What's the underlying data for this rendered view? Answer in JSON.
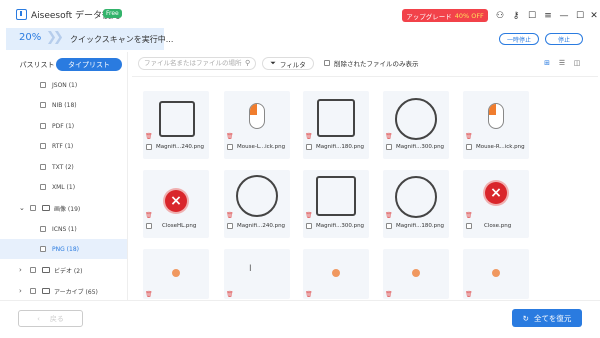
{
  "app": {
    "title": "Aiseesoft データ復元",
    "badge": "Free",
    "promo_label": "アップグレード",
    "promo_discount": "40% OFF",
    "icons": [
      "cart-icon",
      "key-icon",
      "chat-icon",
      "menu-icon",
      "minimize-icon",
      "maximize-icon",
      "close-icon"
    ]
  },
  "scan": {
    "percent": "20%",
    "progress": 0.2,
    "status": "クイックスキャンを実行中...",
    "pause_label": "一時停止",
    "stop_label": "停止"
  },
  "tabs": {
    "path_list": "パスリスト",
    "type_list": "タイプリスト"
  },
  "tree": [
    {
      "label": "JSON (1)",
      "level": 1
    },
    {
      "label": "NIB (18)",
      "level": 1
    },
    {
      "label": "PDF (1)",
      "level": 1
    },
    {
      "label": "RTF (1)",
      "level": 1
    },
    {
      "label": "TXT (2)",
      "level": 1
    },
    {
      "label": "XML (1)",
      "level": 1
    },
    {
      "label": "画像 (19)",
      "level": 0,
      "expanded": true
    },
    {
      "label": "ICNS (1)",
      "level": 1
    },
    {
      "label": "PNG (18)",
      "level": 1,
      "selected": true
    },
    {
      "label": "ビデオ (2)",
      "level": 0,
      "expanded": false
    },
    {
      "label": "アーカイブ (65)",
      "level": 0,
      "expanded": false
    }
  ],
  "toolbar": {
    "search_placeholder": "ファイル名またはファイルの場所",
    "filter_label": "フィルタ",
    "deleted_only_label": "削除されたファイルのみ表示"
  },
  "files": [
    {
      "name": "Magnifi...240.png",
      "kind": "square"
    },
    {
      "name": "Mouse-L...ick.png",
      "kind": "mouse-left"
    },
    {
      "name": "Magnifi...180.png",
      "kind": "square"
    },
    {
      "name": "Magnifi...300.png",
      "kind": "circle"
    },
    {
      "name": "Mouse-R...ick.png",
      "kind": "mouse-right"
    },
    {
      "name": "CloseHL.png",
      "kind": "x"
    },
    {
      "name": "Magnifi...240.png",
      "kind": "circle"
    },
    {
      "name": "Magnifi...300.png",
      "kind": "square"
    },
    {
      "name": "Magnifi...180.png",
      "kind": "circle"
    },
    {
      "name": "Close.png",
      "kind": "x"
    },
    {
      "name": "",
      "kind": "small"
    },
    {
      "name": "",
      "kind": "cursor"
    },
    {
      "name": "",
      "kind": "small"
    },
    {
      "name": "",
      "kind": "small"
    },
    {
      "name": "",
      "kind": "small"
    }
  ],
  "footer": {
    "back_label": "戻る",
    "recover_label": "全てを復元"
  },
  "colors": {
    "accent": "#2a7be0",
    "promo": "#f2424a",
    "free_badge": "#33b36b",
    "selected_row": "#e7f0fc"
  }
}
